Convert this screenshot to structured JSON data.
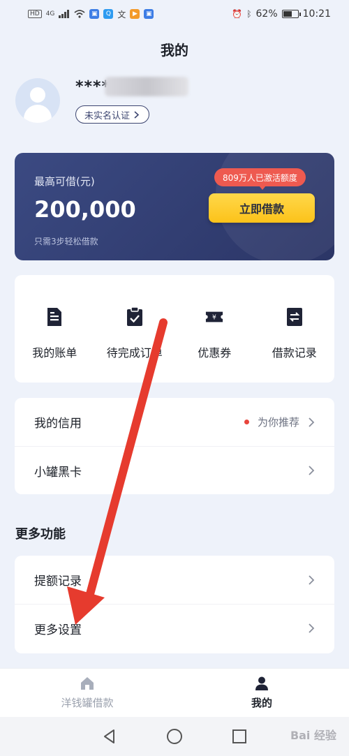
{
  "status_bar": {
    "left_badge": "HD",
    "network": "4G",
    "battery_percent": "62%",
    "time": "10:21",
    "battery_level": 0.62
  },
  "page_title": "我的",
  "profile": {
    "username": "*****",
    "verify_badge": "未实名认证"
  },
  "loan_card": {
    "label": "最高可借(元)",
    "amount": "200,000",
    "note": "只需3步轻松借款",
    "activated_bubble": "809万人已激活额度",
    "borrow_button": "立即借款"
  },
  "quick_actions": [
    {
      "label": "我的账单",
      "icon": "bill-icon"
    },
    {
      "label": "待完成订单",
      "icon": "clipboard-check-icon"
    },
    {
      "label": "优惠券",
      "icon": "coupon-icon"
    },
    {
      "label": "借款记录",
      "icon": "exchange-record-icon"
    }
  ],
  "credit_list": [
    {
      "label": "我的信用",
      "recommend": "为你推荐"
    },
    {
      "label": "小罐黑卡"
    }
  ],
  "more_section": {
    "title": "更多功能",
    "items": [
      {
        "label": "提额记录"
      },
      {
        "label": "更多设置"
      }
    ]
  },
  "tab_bar": [
    {
      "label": "洋钱罐借款",
      "icon": "home-icon",
      "active": false
    },
    {
      "label": "我的",
      "icon": "person-icon",
      "active": true
    }
  ],
  "watermark": "Bai 经验",
  "colors": {
    "background": "#eef2fa",
    "card_navy": "#2b3566",
    "button_yellow": "#fcc21a",
    "bubble_red": "#ee5a50",
    "arrow_red": "#e63b2e"
  }
}
